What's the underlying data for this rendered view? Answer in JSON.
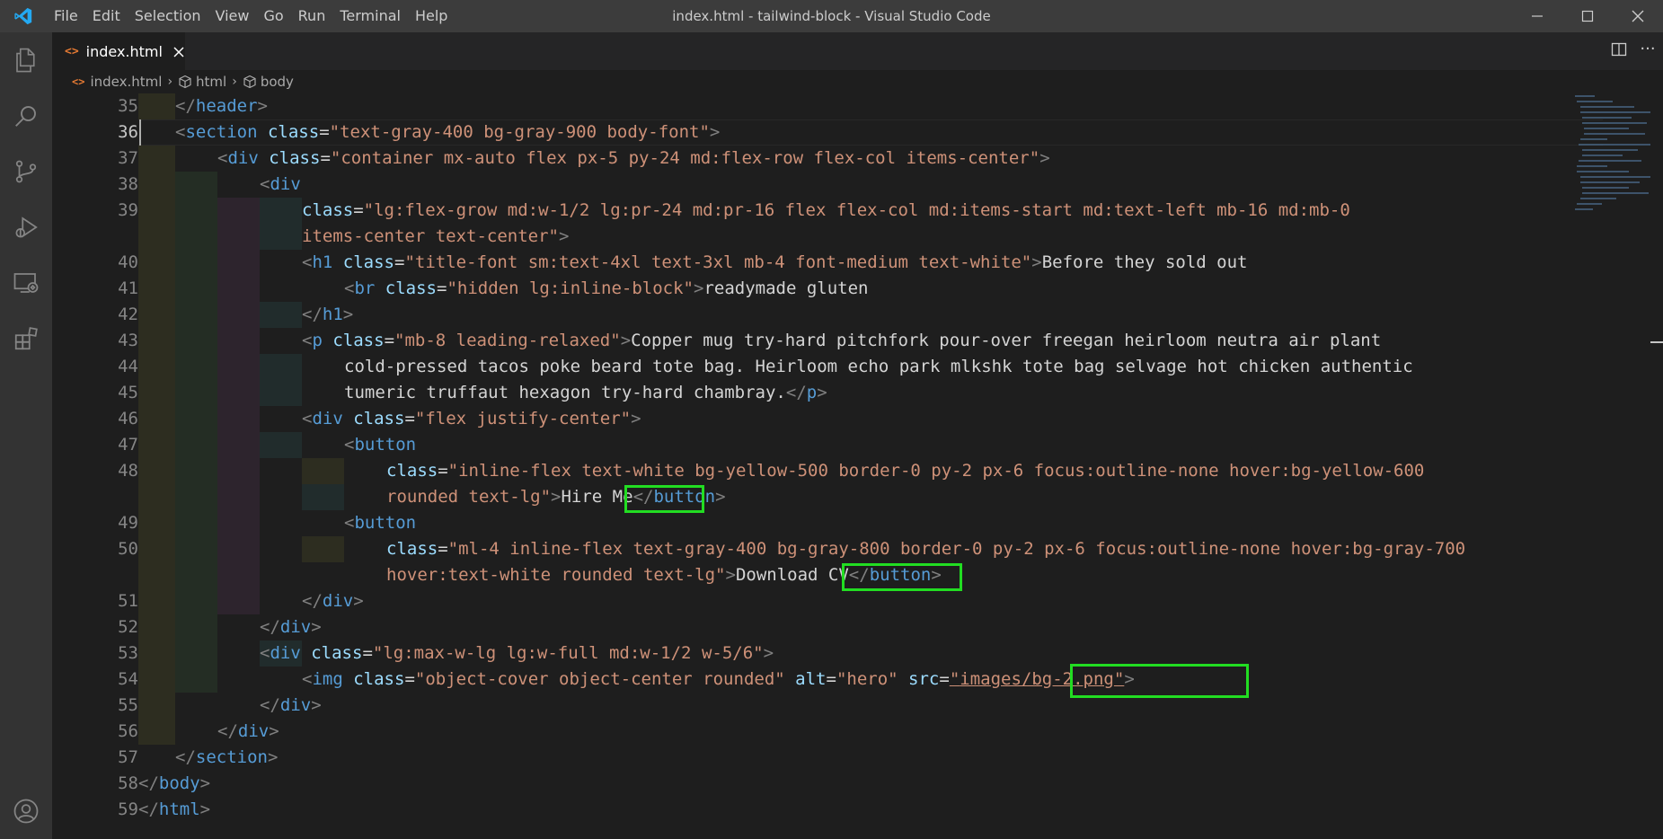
{
  "window": {
    "title": "index.html - tailwind-block - Visual Studio Code",
    "menu": [
      "File",
      "Edit",
      "Selection",
      "View",
      "Go",
      "Run",
      "Terminal",
      "Help"
    ]
  },
  "activity_bar": {
    "items": [
      "explorer-icon",
      "search-icon",
      "source-control-icon",
      "run-debug-icon",
      "remote-explorer-icon",
      "extensions-icon"
    ],
    "bottom": [
      "accounts-icon"
    ]
  },
  "tabs": [
    {
      "label": "index.html",
      "icon": "html-file-icon",
      "active": true
    }
  ],
  "breadcrumbs": [
    "index.html",
    "html",
    "body"
  ],
  "editor": {
    "active_line": 36,
    "line_numbers": [
      "35",
      "36",
      "37",
      "38",
      "39",
      "",
      "40",
      "41",
      "42",
      "43",
      "44",
      "45",
      "46",
      "47",
      "48",
      "",
      "49",
      "50",
      "",
      "51",
      "52",
      "53",
      "54",
      "55",
      "56",
      "57",
      "58",
      "59"
    ],
    "highlighted_text": [
      "Hire Me",
      "Download CV",
      "images/bg-2.png"
    ],
    "highlight_color": "#22dd22"
  },
  "colors": {
    "tag": "#569cd6",
    "attribute": "#9cdcfe",
    "string": "#ce9178",
    "text": "#d4d4d4",
    "punctuation": "#808080",
    "line_number": "#858585"
  }
}
